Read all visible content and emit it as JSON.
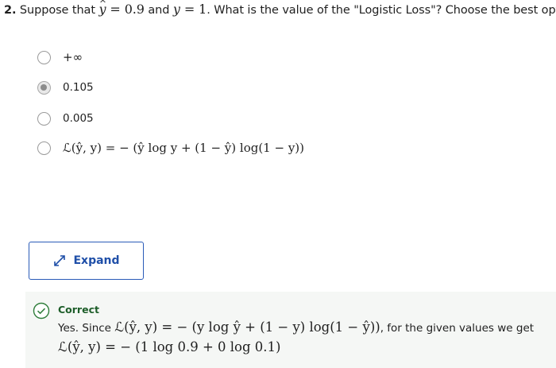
{
  "question": {
    "number": "2.",
    "text_before": "Suppose that",
    "yhat_value": "= 0.9",
    "and": "and",
    "y_value": "= 1",
    "text_after": ". What is the value of the \"Logistic Loss\"? Choose the best option."
  },
  "options": [
    {
      "label": "+∞",
      "selected": false
    },
    {
      "label": "0.105",
      "selected": true
    },
    {
      "label": "0.005",
      "selected": false
    },
    {
      "label": "ℒ(ŷ, y) = − (ŷ log y + (1 − ŷ) log(1 − y))",
      "selected": false
    }
  ],
  "expand": {
    "label": "Expand"
  },
  "feedback": {
    "status": "Correct",
    "text_prefix": "Yes. Since",
    "formula": "ℒ(ŷ, y) = − (y log ŷ + (1 − y) log(1 − ŷ))",
    "text_suffix": ", for the given values we get",
    "result": "ℒ(ŷ, y) = − (1 log 0.9 + 0 log 0.1)"
  },
  "colors": {
    "accent": "#1f4fa8",
    "correct": "#1e5e2a",
    "feedback_bg": "#f5f7f5"
  }
}
